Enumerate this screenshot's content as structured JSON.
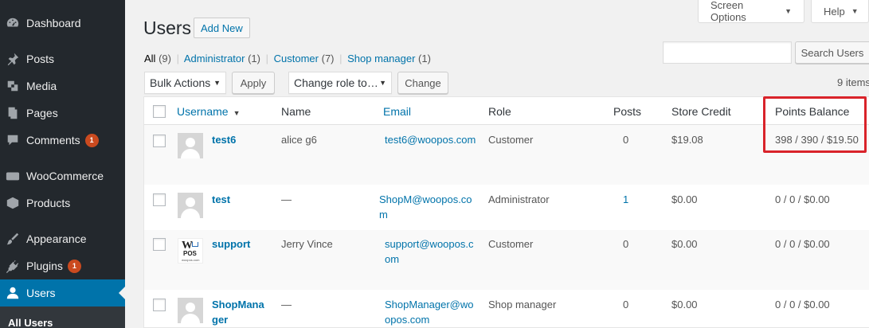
{
  "sidebar": {
    "items": [
      {
        "label": "Dashboard",
        "icon": "dashboard-icon",
        "badge": ""
      },
      {
        "label": "Posts",
        "icon": "pin-icon",
        "badge": ""
      },
      {
        "label": "Media",
        "icon": "media-icon",
        "badge": ""
      },
      {
        "label": "Pages",
        "icon": "pages-icon",
        "badge": ""
      },
      {
        "label": "Comments",
        "icon": "comment-icon",
        "badge": "1"
      },
      {
        "label": "WooCommerce",
        "icon": "woocommerce-icon",
        "badge": ""
      },
      {
        "label": "Products",
        "icon": "box-icon",
        "badge": ""
      },
      {
        "label": "Appearance",
        "icon": "paintbrush-icon",
        "badge": ""
      },
      {
        "label": "Plugins",
        "icon": "plugin-icon",
        "badge": "1"
      },
      {
        "label": "Users",
        "icon": "user-icon",
        "badge": ""
      }
    ],
    "submenu_current": "All Users"
  },
  "top_tabs": {
    "screen_options": "Screen Options",
    "help": "Help"
  },
  "header": {
    "title": "Users",
    "add_new": "Add New"
  },
  "filters": [
    {
      "label": "All",
      "count": "(9)"
    },
    {
      "label": "Administrator",
      "count": "(1)"
    },
    {
      "label": "Customer",
      "count": "(7)"
    },
    {
      "label": "Shop manager",
      "count": "(1)"
    }
  ],
  "search": {
    "value": "",
    "button": "Search Users"
  },
  "toolbar": {
    "bulk_actions": "Bulk Actions",
    "apply": "Apply",
    "change_role": "Change role to…",
    "change": "Change",
    "items_count": "9 items"
  },
  "table": {
    "columns": {
      "username": "Username",
      "name": "Name",
      "email": "Email",
      "role": "Role",
      "posts": "Posts",
      "store_credit": "Store Credit",
      "points_balance": "Points Balance"
    },
    "rows": [
      {
        "username": "test6",
        "name": "alice g6",
        "email": "test6@woopos.com",
        "role": "Customer",
        "posts": "0",
        "store_credit": "$19.08",
        "points_balance": "398 / 390 / $19.50"
      },
      {
        "username": "test",
        "name": "—",
        "email": "ShopM@woopos.com",
        "role": "Administrator",
        "posts": "1",
        "store_credit": "$0.00",
        "points_balance": "0 / 0 / $0.00"
      },
      {
        "username": "support",
        "name": "Jerry Vince",
        "email": "support@woopos.com",
        "role": "Customer",
        "posts": "0",
        "store_credit": "$0.00",
        "points_balance": "0 / 0 / $0.00"
      },
      {
        "username": "ShopManager",
        "name": "—",
        "email": "ShopManager@woopos.com",
        "role": "Shop manager",
        "posts": "0",
        "store_credit": "$0.00",
        "points_balance": "0 / 0 / $0.00"
      }
    ]
  },
  "colors": {
    "sidebar_bg": "#23282d",
    "active": "#0073aa",
    "link": "#0073aa",
    "badge": "#ca4a1f",
    "highlight": "#d9232a"
  }
}
